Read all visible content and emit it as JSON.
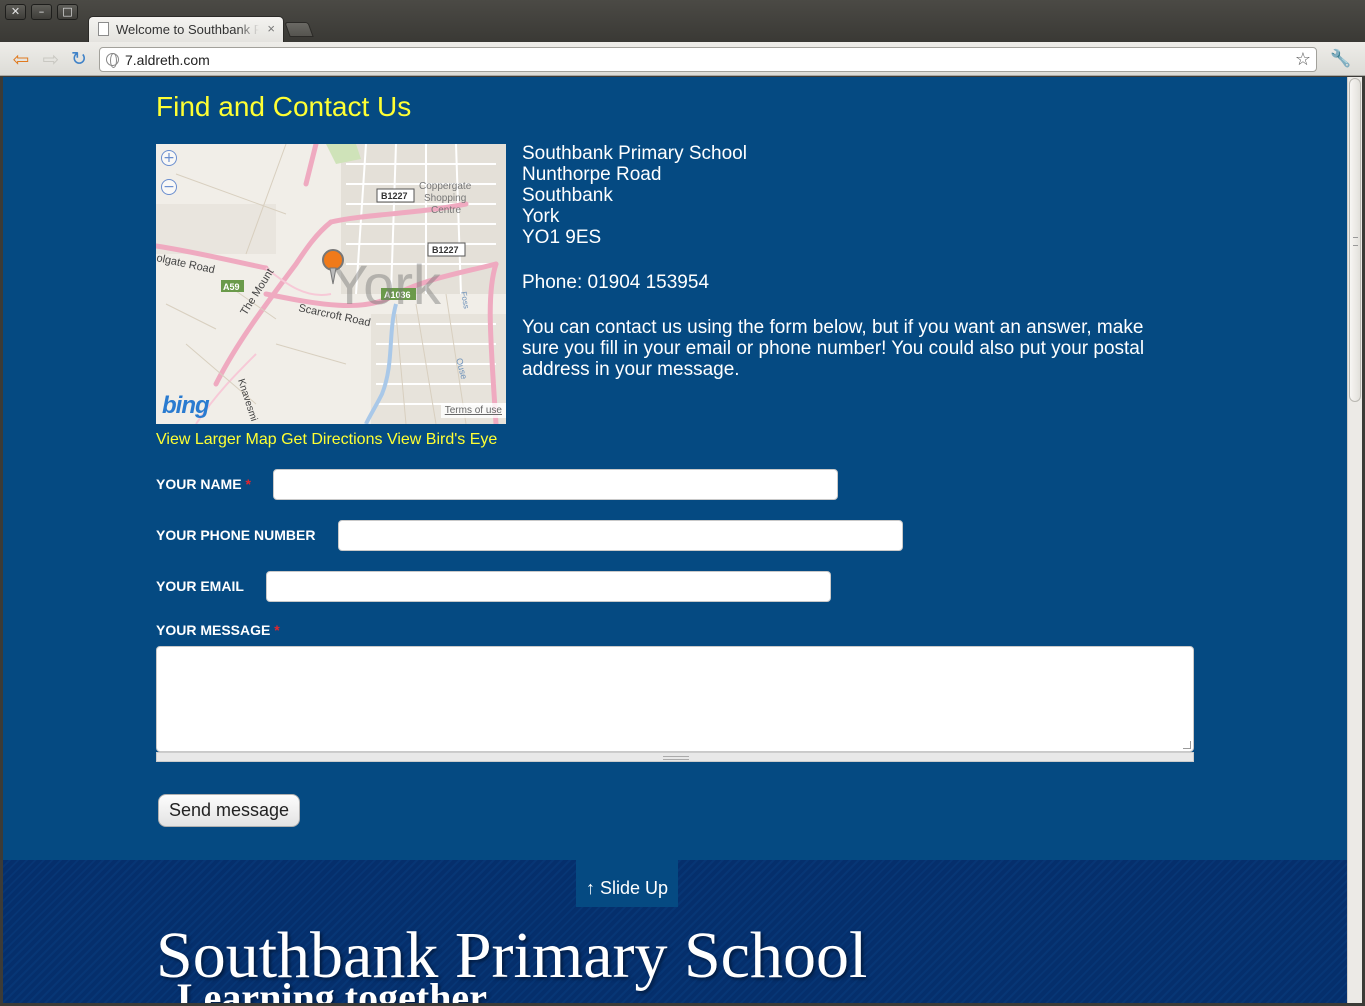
{
  "browser": {
    "tab_title": "Welcome to Southbank Primary School",
    "tab_close": "×",
    "url": "7.aldreth.com"
  },
  "page": {
    "heading": "Find and Contact Us",
    "map": {
      "labels": {
        "coppergate": [
          "Coppergate",
          "Shopping",
          "Centre"
        ],
        "road_b1227_a": "B1227",
        "road_b1227_b": "B1227",
        "road_a59": "A59",
        "road_a1036": "A1036",
        "holgate": "olgate Road",
        "mount": "The Mount",
        "scarcroft": "Scarcroft Road",
        "knavesmire": "Knavesmi",
        "york": "York",
        "ouse": "Ouse",
        "foss": "Foss"
      },
      "bing": "bing",
      "terms": "Terms of use",
      "zoom_in": "+",
      "zoom_out": "−"
    },
    "map_links": {
      "larger": "View Larger Map",
      "directions": "Get Directions",
      "birds_eye": "View Bird's Eye"
    },
    "address": {
      "lines": [
        "Southbank Primary School",
        "Nunthorpe Road",
        "Southbank",
        "York",
        "YO1 9ES"
      ],
      "phone": "Phone: 01904 153954",
      "note": "You can contact us using the form below, but if you want an answer, make sure you fill in your email or phone number!  You could also put your postal address in your message."
    },
    "form": {
      "name_label": "YOUR NAME",
      "phone_label": "YOUR PHONE NUMBER",
      "email_label": "YOUR EMAIL",
      "message_label": "YOUR MESSAGE",
      "required_mark": "*",
      "name_value": "",
      "phone_value": "",
      "email_value": "",
      "message_value": "",
      "submit_label": "Send message"
    },
    "footer": {
      "slide_up": "↑ Slide Up",
      "school_name": "Southbank Primary School",
      "tagline": "Learning together"
    }
  },
  "colors": {
    "page_bg": "#054a82",
    "accent_yellow": "#ffff33",
    "required_red": "#e2262d",
    "footer_bg": "#052f6c"
  },
  "icons": [
    "close-icon",
    "minimize-icon",
    "maximize-icon",
    "page-icon",
    "back-icon",
    "forward-icon",
    "reload-icon",
    "globe-icon",
    "star-icon",
    "wrench-icon",
    "map-pin-icon",
    "zoom-in-icon",
    "zoom-out-icon"
  ]
}
